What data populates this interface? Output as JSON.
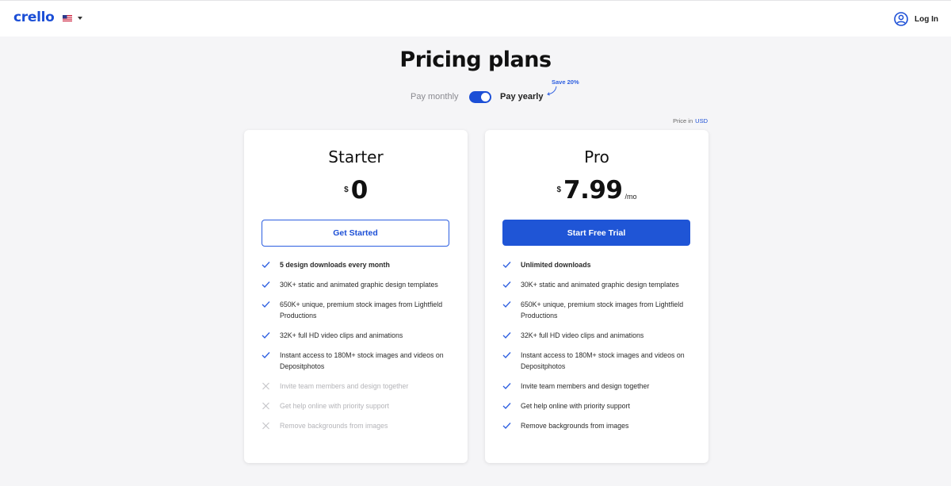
{
  "header": {
    "logo": "crello",
    "language_flag": "us-flag-icon",
    "login_label": "Log In"
  },
  "page_title": "Pricing plans",
  "billing": {
    "monthly_label": "Pay monthly",
    "yearly_label": "Pay yearly",
    "yearly_selected": true,
    "save_badge": "Save 20%",
    "price_in_label": "Price in",
    "currency": "USD"
  },
  "plans": [
    {
      "name": "Starter",
      "currency_symbol": "$",
      "price": "0",
      "period": "",
      "cta_label": "Get Started",
      "features": [
        {
          "text": "5 design downloads every month",
          "included": true
        },
        {
          "text": "30K+ static and animated graphic design templates",
          "included": true
        },
        {
          "text": "650K+ unique, premium stock images from Lightfield Productions",
          "included": true
        },
        {
          "text": "32K+ full HD video clips and animations",
          "included": true
        },
        {
          "text": "Instant access to 180M+ stock images and videos on Depositphotos",
          "included": true
        },
        {
          "text": "Invite team members and design together",
          "included": false
        },
        {
          "text": "Get help online with priority support",
          "included": false
        },
        {
          "text": "Remove backgrounds from images",
          "included": false
        }
      ]
    },
    {
      "name": "Pro",
      "currency_symbol": "$",
      "price": "7.99",
      "period": "/mo",
      "cta_label": "Start Free Trial",
      "features": [
        {
          "text": "Unlimited downloads",
          "included": true
        },
        {
          "text": "30K+ static and animated graphic design templates",
          "included": true
        },
        {
          "text": "650K+ unique, premium stock images from Lightfield Productions",
          "included": true
        },
        {
          "text": "32K+ full HD video clips and animations",
          "included": true
        },
        {
          "text": "Instant access to 180M+ stock images and videos on Depositphotos",
          "included": true
        },
        {
          "text": "Invite team members and design together",
          "included": true
        },
        {
          "text": "Get help online with priority support",
          "included": true
        },
        {
          "text": "Remove backgrounds from images",
          "included": true
        }
      ]
    }
  ],
  "colors": {
    "brand_blue": "#1c4fd6",
    "check_blue": "#2c5ee0",
    "disabled_gray": "#b4b4b8"
  }
}
